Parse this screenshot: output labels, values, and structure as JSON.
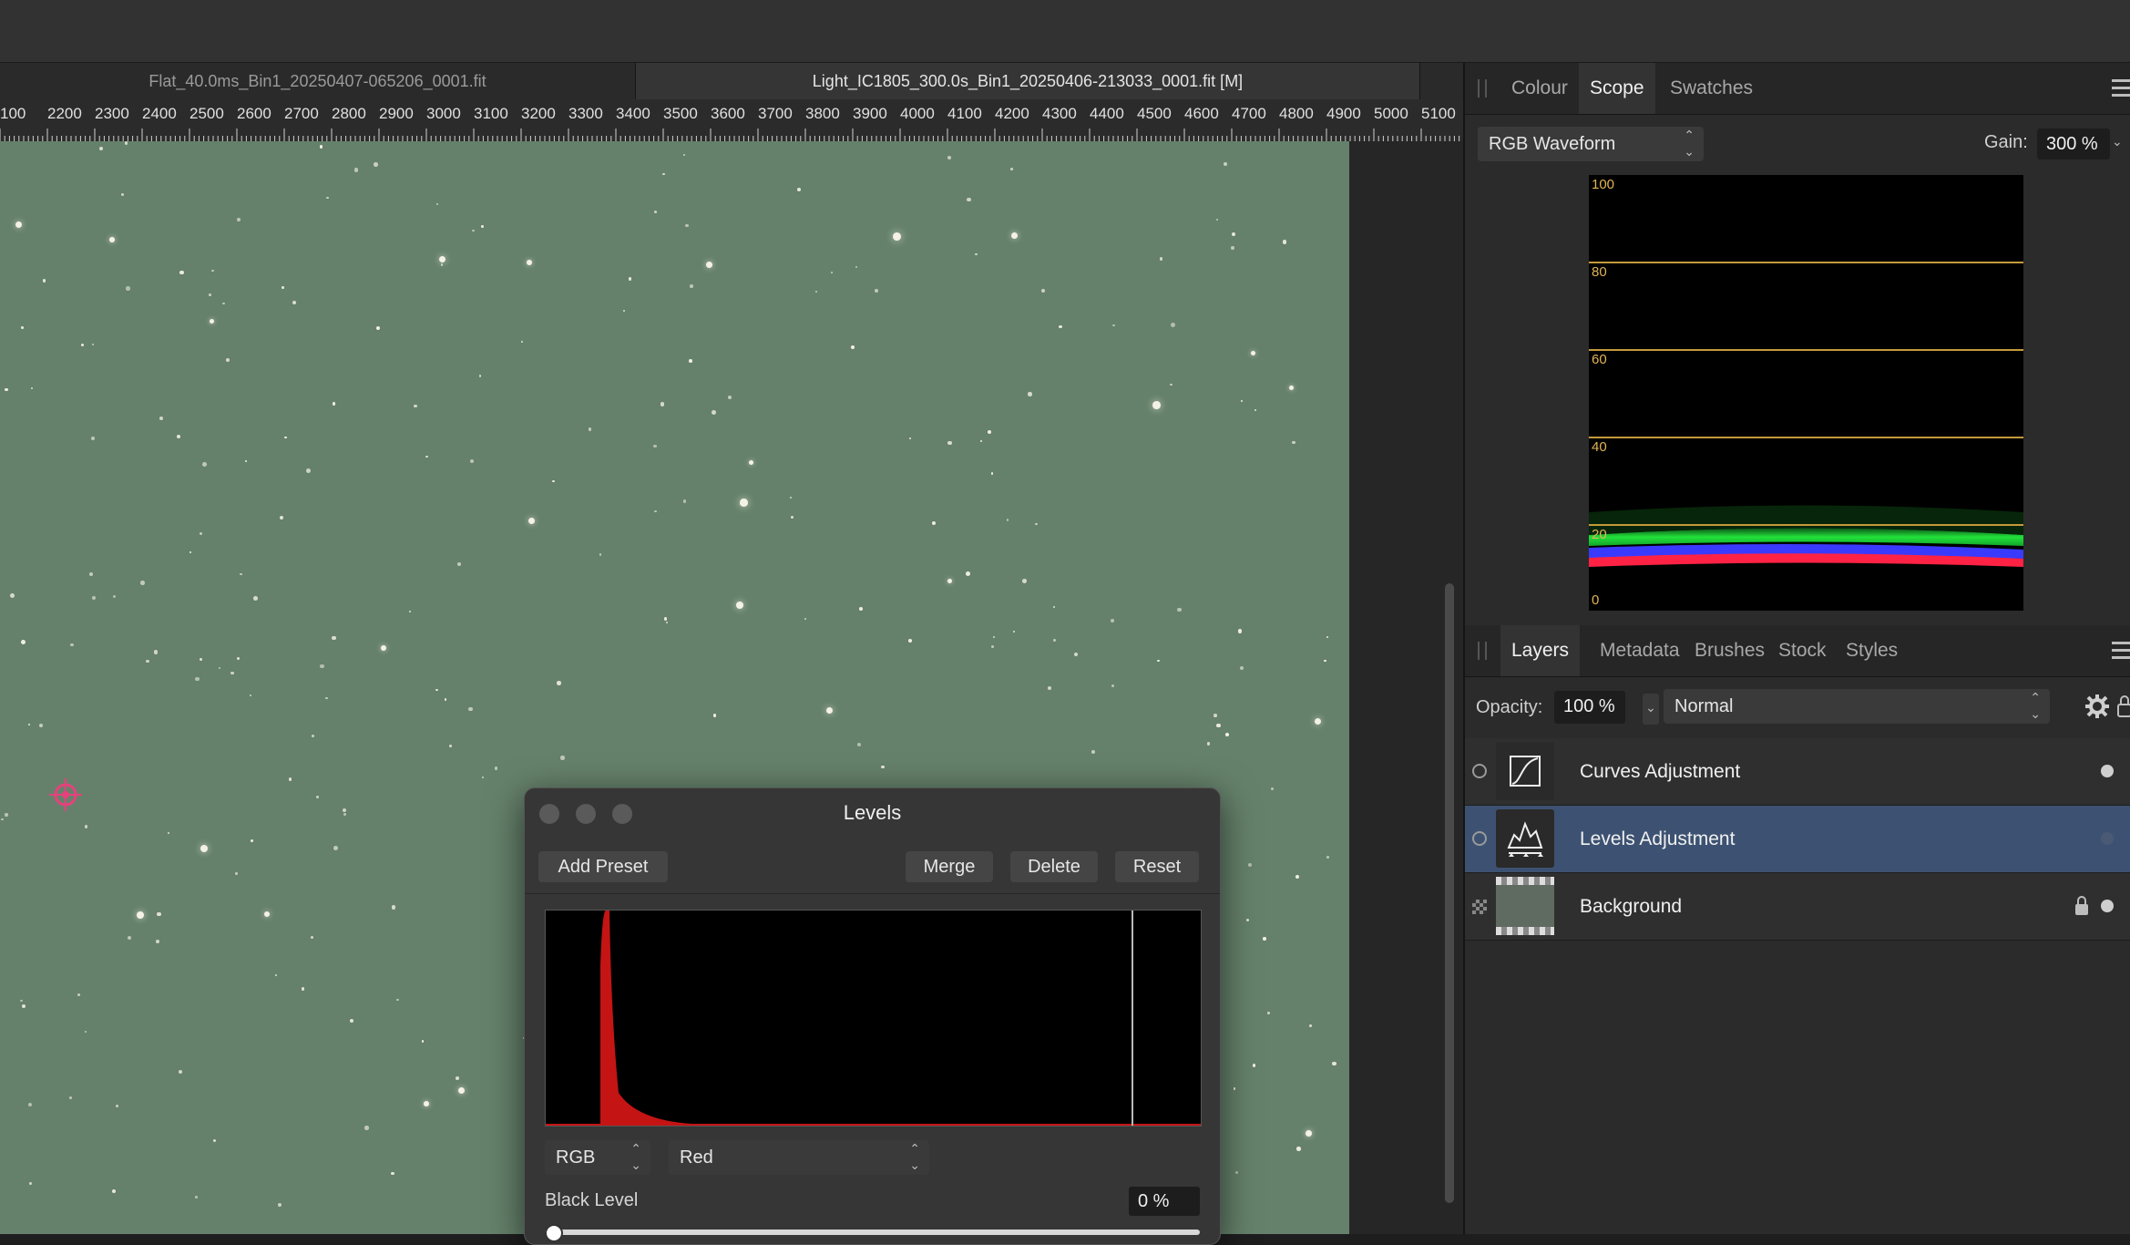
{
  "document_tabs": [
    {
      "label": "Flat_40.0ms_Bin1_20250407-065206_0001.fit",
      "active": false
    },
    {
      "label": "Light_IC1805_300.0s_Bin1_20250406-213033_0001.fit [M]",
      "active": true
    }
  ],
  "ruler": {
    "labels": [
      "100",
      "2200",
      "2300",
      "2400",
      "2500",
      "2600",
      "2700",
      "2800",
      "2900",
      "3000",
      "3100",
      "3200",
      "3300",
      "3400",
      "3500",
      "3600",
      "3700",
      "3800",
      "3900",
      "4000",
      "4100",
      "4200",
      "4300",
      "4400",
      "4500",
      "4600",
      "4700",
      "4800",
      "4900",
      "5000",
      "5100"
    ]
  },
  "scope_panel": {
    "tabs": [
      "Colour",
      "Scope",
      "Swatches"
    ],
    "active_tab": "Scope",
    "mode": "RGB Waveform",
    "gain_label": "Gain:",
    "gain_value": "300 %",
    "waveform_labels": [
      "100",
      "80",
      "60",
      "40",
      "20",
      "0"
    ],
    "waveform_colors": {
      "green": "#22e23a",
      "blue": "#3a3aff",
      "red": "#ff2244"
    }
  },
  "layers_panel": {
    "tabs": [
      "Layers",
      "Metadata",
      "Brushes",
      "Stock",
      "Styles"
    ],
    "active_tab": "Layers",
    "opacity_label": "Opacity:",
    "opacity_value": "100 %",
    "blend_mode": "Normal",
    "layers": [
      {
        "name": "Curves Adjustment",
        "selected": false,
        "icon": "curves-icon"
      },
      {
        "name": "Levels Adjustment",
        "selected": true,
        "icon": "levels-icon"
      },
      {
        "name": "Background",
        "selected": false,
        "icon": "image-thumbnail",
        "locked": true
      }
    ]
  },
  "levels_dialog": {
    "title": "Levels",
    "add_preset": "Add Preset",
    "merge": "Merge",
    "delete": "Delete",
    "reset": "Reset",
    "channel_mode": "RGB",
    "channel": "Red",
    "black_level_label": "Black Level",
    "black_level_value": "0 %",
    "histogram_color": "#c41414"
  },
  "colors": {
    "canvas": "#65816b",
    "selection": "#3d5272",
    "accent_orange": "#c49a3a"
  }
}
